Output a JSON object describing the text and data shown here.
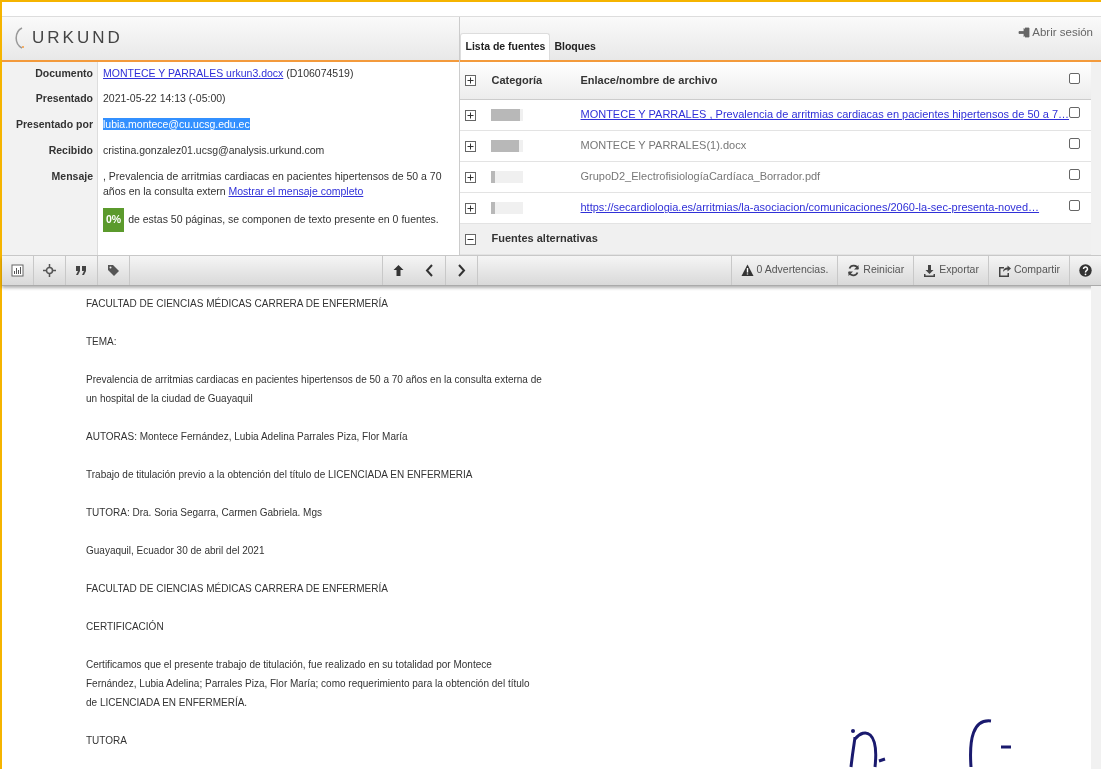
{
  "header": {
    "logo": "URKUND",
    "login": "Abrir sesión"
  },
  "details": [
    {
      "label": "Documento",
      "kind": "link",
      "value": "MONTECE Y PARRALES urkun3.docx",
      "suffix": "(D106074519)"
    },
    {
      "label": "Presentado",
      "kind": "text",
      "value": "2021-05-22 14:13 (-05:00)"
    },
    {
      "label": "Presentado por",
      "kind": "highlight",
      "value": "lubia.montece@cu.ucsg.edu.ec"
    },
    {
      "label": "Recibido",
      "kind": "text",
      "value": "cristina.gonzalez01.ucsg@analysis.urkund.com"
    },
    {
      "label": "Mensaje",
      "kind": "message",
      "value": ", Prevalencia de arritmias cardiacas en pacientes hipertensos de 50 a 70 años en la consulta extern",
      "link": "Mostrar el mensaje completo"
    }
  ],
  "score": {
    "badge": "0%",
    "text": "de estas 50 páginas, se componen de texto presente en 0 fuentes."
  },
  "tabs": [
    {
      "label": "Lista de fuentes",
      "selected": true
    },
    {
      "label": "Bloques",
      "selected": false
    }
  ],
  "sources": {
    "header": {
      "expanded": false,
      "category": "Categoría",
      "name": "Enlace/nombre de archivo",
      "checked": false
    },
    "rows": [
      {
        "expanded": false,
        "level": 0.9,
        "kind": "link",
        "name": "MONTECE Y PARRALES , Prevalencia de arritmias cardiacas en pacientes hipertensos de 50 a 7…",
        "checked": false
      },
      {
        "expanded": false,
        "level": 0.85,
        "kind": "file",
        "name": "MONTECE Y PARRALES(1).docx",
        "checked": false
      },
      {
        "expanded": false,
        "level": 0.1,
        "kind": "file",
        "name": "GrupoD2_ElectrofisiologíaCardíaca_Borrador.pdf",
        "checked": false
      },
      {
        "expanded": false,
        "level": 0.1,
        "kind": "link",
        "name": "https://secardiologia.es/arritmias/la-asociacion/comunicaciones/2060-la-sec-presenta-noved…",
        "checked": false
      }
    ],
    "group": {
      "expanded": true,
      "label": "Fuentes alternativas"
    }
  },
  "toolbar": {
    "right": [
      "0 Advertencias.",
      "Reiniciar",
      "Exportar",
      "Compartir"
    ]
  },
  "document": [
    "FACULTAD DE CIENCIAS MÉDICAS CARRERA DE ENFERMERÍA",
    "TEMA:",
    "Prevalencia de arritmias cardiacas en pacientes hipertensos de 50 a 70 años en la consulta externa de un hospital de la ciudad de Guayaquil",
    "AUTORAS: Montece Fernández, Lubia Adelina Parrales Piza, Flor María",
    "Trabajo de titulación previo a la obtención del título de LICENCIADA EN ENFERMERIA",
    "TUTORA: Dra. Soria Segarra, Carmen Gabriela. Mgs",
    "Guayaquil, Ecuador 30 de abril del 2021",
    "FACULTAD DE CIENCIAS MÉDICAS CARRERA DE ENFERMERÍA",
    "CERTIFICACIÓN",
    "Certificamos que el presente trabajo de titulación, fue realizado en su totalidad por Montece Fernández, Lubia Adelina; Parrales Piza, Flor María; como requerimiento para la obtención del título de LICENCIADA EN ENFERMERÍA.",
    "TUTORA"
  ]
}
